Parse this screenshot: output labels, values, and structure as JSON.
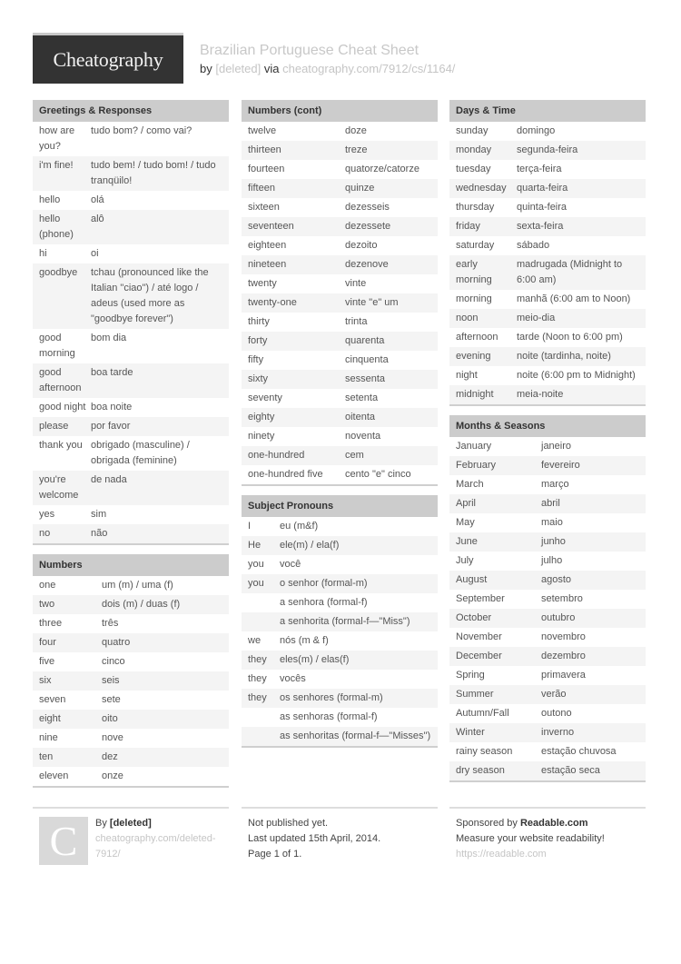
{
  "header": {
    "logo_text": "Cheatography",
    "title": "Brazilian Portuguese Cheat Sheet",
    "by_label": "by",
    "author": "[deleted]",
    "via_label": "via",
    "url": "cheatography.com/7912/cs/1164/"
  },
  "sections": {
    "greetings": {
      "title": "Greetings & Responses",
      "rows": [
        {
          "en": "how are you?",
          "pt": "tudo bom? / como vai?"
        },
        {
          "en": "i'm fine!",
          "pt": "tudo bem! / tudo bom! / tudo tranqüilo!"
        },
        {
          "en": "hello",
          "pt": "olá"
        },
        {
          "en": "hello (phone)",
          "pt": "alô"
        },
        {
          "en": "hi",
          "pt": "oi"
        },
        {
          "en": "goodbye",
          "pt": "tchau (pronounced like the Italian \"ciao\") / até logo / adeus (used more as \"goodbye forever\")"
        },
        {
          "en": "good morning",
          "pt": "bom dia"
        },
        {
          "en": "good afternoon",
          "pt": "boa tarde"
        },
        {
          "en": "good night",
          "pt": "boa noite"
        },
        {
          "en": "please",
          "pt": "por favor"
        },
        {
          "en": "thank you",
          "pt": "obrigado (masculine) / obrigada (feminine)"
        },
        {
          "en": "you're welcome",
          "pt": "de nada"
        },
        {
          "en": "yes",
          "pt": "sim"
        },
        {
          "en": "no",
          "pt": "não"
        }
      ]
    },
    "numbers": {
      "title": "Numbers",
      "rows": [
        {
          "en": "one",
          "pt": "um (m) / uma (f)"
        },
        {
          "en": "two",
          "pt": "dois (m) / duas (f)"
        },
        {
          "en": "three",
          "pt": "três"
        },
        {
          "en": "four",
          "pt": "quatro"
        },
        {
          "en": "five",
          "pt": "cinco"
        },
        {
          "en": "six",
          "pt": "seis"
        },
        {
          "en": "seven",
          "pt": "sete"
        },
        {
          "en": "eight",
          "pt": "oito"
        },
        {
          "en": "nine",
          "pt": "nove"
        },
        {
          "en": "ten",
          "pt": "dez"
        },
        {
          "en": "eleven",
          "pt": "onze"
        }
      ]
    },
    "numbers_cont": {
      "title": "Numbers (cont)",
      "rows": [
        {
          "en": "twelve",
          "pt": "doze"
        },
        {
          "en": "thirteen",
          "pt": "treze"
        },
        {
          "en": "fourteen",
          "pt": "quatorze/catorze"
        },
        {
          "en": "fifteen",
          "pt": "quinze"
        },
        {
          "en": "sixteen",
          "pt": "dezesseis"
        },
        {
          "en": "seventeen",
          "pt": "dezessete"
        },
        {
          "en": "eighteen",
          "pt": "dezoito"
        },
        {
          "en": "nineteen",
          "pt": "dezenove"
        },
        {
          "en": "twenty",
          "pt": "vinte"
        },
        {
          "en": "twenty-one",
          "pt": "vinte \"e\" um"
        },
        {
          "en": "thirty",
          "pt": "trinta"
        },
        {
          "en": "forty",
          "pt": "quarenta"
        },
        {
          "en": "fifty",
          "pt": "cinquenta"
        },
        {
          "en": "sixty",
          "pt": "sessenta"
        },
        {
          "en": "seventy",
          "pt": "setenta"
        },
        {
          "en": "eighty",
          "pt": "oitenta"
        },
        {
          "en": "ninety",
          "pt": "noventa"
        },
        {
          "en": "one-hundred",
          "pt": "cem"
        },
        {
          "en": "one-hundred five",
          "pt": "cento \"e\" cinco"
        }
      ]
    },
    "pronouns": {
      "title": "Subject Pronouns",
      "rows": [
        {
          "en": "I",
          "pt": "eu (m&f)"
        },
        {
          "en": "He",
          "pt": "ele(m) / ela(f)"
        },
        {
          "en": "you",
          "pt": "você"
        },
        {
          "en": "you",
          "pt": "o senhor (formal-m)"
        },
        {
          "en": "",
          "pt": "a senhora (formal-f)"
        },
        {
          "en": "",
          "pt": "a senhorita (formal-f—\"Miss\")"
        },
        {
          "en": "we",
          "pt": "nós (m & f)"
        },
        {
          "en": "they",
          "pt": "eles(m) / elas(f)"
        },
        {
          "en": "they",
          "pt": "vocês"
        },
        {
          "en": "they",
          "pt": "os senhores (formal-m)"
        },
        {
          "en": "",
          "pt": "as senhoras (formal-f)"
        },
        {
          "en": "",
          "pt": "as senhoritas (formal-f—\"Misses\")"
        }
      ]
    },
    "days": {
      "title": "Days & Time",
      "rows": [
        {
          "en": "sunday",
          "pt": "domingo"
        },
        {
          "en": "monday",
          "pt": "segunda-feira"
        },
        {
          "en": "tuesday",
          "pt": "terça-feira"
        },
        {
          "en": "wednesday",
          "pt": "quarta-feira"
        },
        {
          "en": "thursday",
          "pt": "quinta-feira"
        },
        {
          "en": "friday",
          "pt": "sexta-feira"
        },
        {
          "en": "saturday",
          "pt": "sábado"
        },
        {
          "en": "early morning",
          "pt": "madrugada (Midnight to 6:00 am)"
        },
        {
          "en": "morning",
          "pt": "manhã (6:00 am to Noon)"
        },
        {
          "en": "noon",
          "pt": "meio-dia"
        },
        {
          "en": "afternoon",
          "pt": "tarde (Noon to 6:00 pm)"
        },
        {
          "en": "evening",
          "pt": "noite (tardinha, noite)"
        },
        {
          "en": "night",
          "pt": "noite (6:00 pm to Midnight)"
        },
        {
          "en": "midnight",
          "pt": "meia-noite"
        }
      ]
    },
    "months": {
      "title": "Months & Seasons",
      "rows": [
        {
          "en": "January",
          "pt": "janeiro"
        },
        {
          "en": "February",
          "pt": "fevereiro"
        },
        {
          "en": "March",
          "pt": "março"
        },
        {
          "en": "April",
          "pt": "abril"
        },
        {
          "en": "May",
          "pt": "maio"
        },
        {
          "en": "June",
          "pt": "junho"
        },
        {
          "en": "July",
          "pt": "julho"
        },
        {
          "en": "August",
          "pt": "agosto"
        },
        {
          "en": "September",
          "pt": "setembro"
        },
        {
          "en": "October",
          "pt": "outubro"
        },
        {
          "en": "November",
          "pt": "novembro"
        },
        {
          "en": "December",
          "pt": "dezembro"
        },
        {
          "en": "Spring",
          "pt": "primavera"
        },
        {
          "en": "Summer",
          "pt": "verão"
        },
        {
          "en": "Autumn/Fall",
          "pt": "outono"
        },
        {
          "en": "Winter",
          "pt": "inverno"
        },
        {
          "en": "rainy season",
          "pt": "estação chuvosa"
        },
        {
          "en": "dry season",
          "pt": "estação seca"
        }
      ]
    }
  },
  "footer": {
    "author": {
      "avatar_letter": "C",
      "by_label": "By",
      "name": "[deleted]",
      "url": "cheatography.com/deleted-7912/"
    },
    "status": {
      "published": "Not published yet.",
      "updated": "Last updated 15th April, 2014.",
      "page": "Page 1 of 1."
    },
    "sponsor": {
      "label": "Sponsored by",
      "name": "Readable.com",
      "tagline": "Measure your website readability!",
      "url": "https://readable.com"
    }
  }
}
